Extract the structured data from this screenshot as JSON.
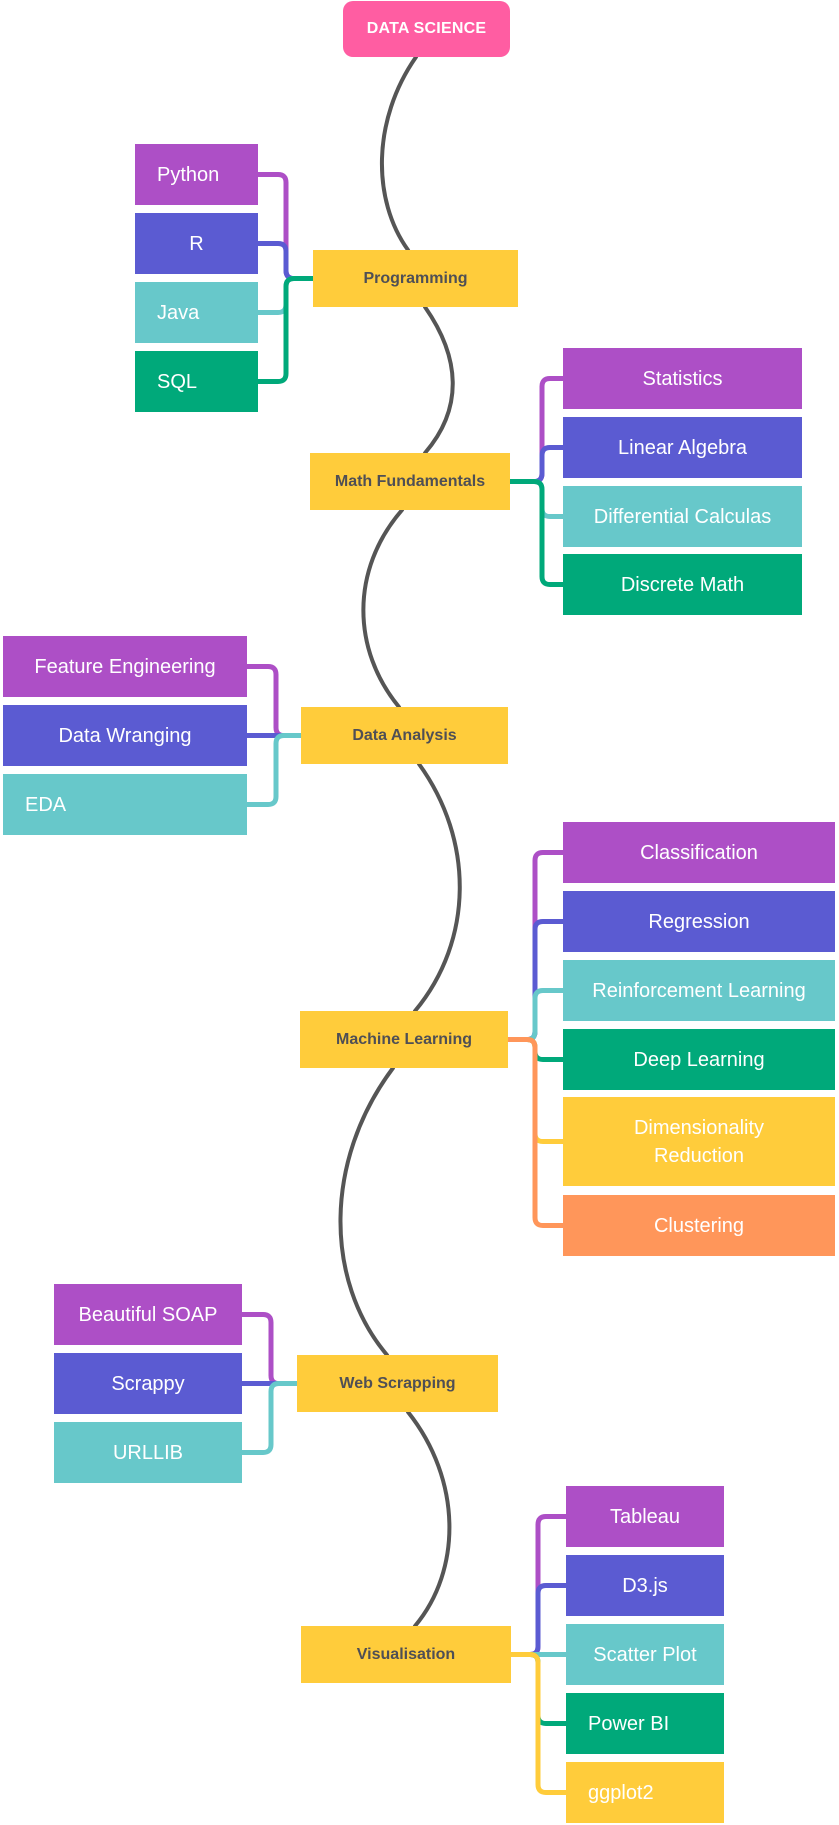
{
  "root": {
    "label": "DATA SCIENCE",
    "color": "#FF5DA2"
  },
  "colors": {
    "topic": "#FFCC3B",
    "spine": "#555555",
    "purple": "#AD4FC6",
    "indigo": "#5B5BD2",
    "teal": "#67C8CA",
    "green": "#00A97A",
    "yellow": "#FFCC3B",
    "orange": "#FF965A"
  },
  "topics": [
    {
      "id": "programming",
      "label": "Programming",
      "side": "left",
      "children": [
        {
          "label": "Python",
          "color": "purple"
        },
        {
          "label": "R",
          "color": "indigo"
        },
        {
          "label": "Java",
          "color": "teal"
        },
        {
          "label": "SQL",
          "color": "green"
        }
      ]
    },
    {
      "id": "math-fundamentals",
      "label": "Math Fundamentals",
      "side": "right",
      "children": [
        {
          "label": "Statistics",
          "color": "purple"
        },
        {
          "label": "Linear Algebra",
          "color": "indigo"
        },
        {
          "label": "Differential Calculas",
          "color": "teal"
        },
        {
          "label": "Discrete Math",
          "color": "green"
        }
      ]
    },
    {
      "id": "data-analysis",
      "label": "Data Analysis",
      "side": "left",
      "children": [
        {
          "label": "Feature Engineering",
          "color": "purple"
        },
        {
          "label": "Data Wranging",
          "color": "indigo"
        },
        {
          "label": "EDA",
          "color": "teal"
        }
      ]
    },
    {
      "id": "machine-learning",
      "label": "Machine Learning",
      "side": "right",
      "children": [
        {
          "label": "Classification",
          "color": "purple"
        },
        {
          "label": "Regression",
          "color": "indigo"
        },
        {
          "label": "Reinforcement Learning",
          "color": "teal"
        },
        {
          "label": "Deep Learning",
          "color": "green"
        },
        {
          "label": "Dimensionality Reduction",
          "color": "yellow"
        },
        {
          "label": "Clustering",
          "color": "orange"
        }
      ]
    },
    {
      "id": "web-scrapping",
      "label": "Web Scrapping",
      "side": "left",
      "children": [
        {
          "label": "Beautiful SOAP",
          "color": "purple"
        },
        {
          "label": "Scrappy",
          "color": "indigo"
        },
        {
          "label": "URLLIB",
          "color": "teal"
        }
      ]
    },
    {
      "id": "visualisation",
      "label": "Visualisation",
      "side": "right",
      "children": [
        {
          "label": "Tableau",
          "color": "purple"
        },
        {
          "label": "D3.js",
          "color": "indigo"
        },
        {
          "label": "Scatter Plot",
          "color": "teal"
        },
        {
          "label": "Power BI",
          "color": "green"
        },
        {
          "label": "ggplot2",
          "color": "yellow"
        }
      ]
    }
  ]
}
